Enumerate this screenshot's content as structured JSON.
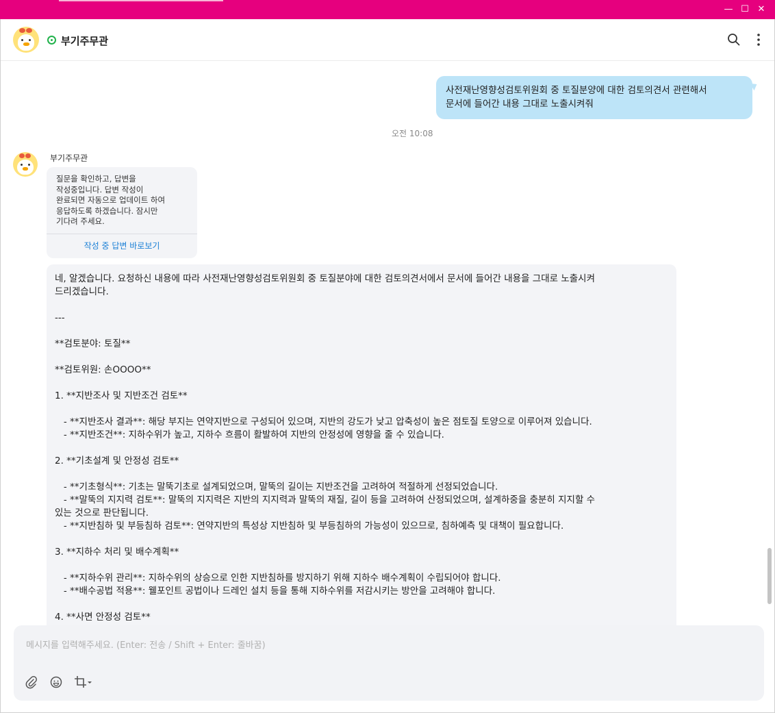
{
  "window": {
    "minimize": "—",
    "maximize": "☐",
    "close": "✕"
  },
  "header": {
    "name": "부기주무관"
  },
  "messages": {
    "user": {
      "text_line1": "사전재난영향성검토위원회 중 토질분양에 대한 검토의견서 관련해서",
      "text_line2": "문서에 들어간 내용 그대로 노출시켜줘",
      "time": "오전 10:08"
    },
    "bot_name": "부기주무관",
    "card": {
      "lines": [
        "질문을 확인하고, 답변을",
        "작성중입니다. 답변 작성이",
        "완료되면 자동으로 업데이트 하여",
        "응답하도록 하겠습니다. 잠시만",
        "기다려 주세요."
      ],
      "link": "작성 중 답변 바로보기"
    },
    "answer_lines": [
      "네, 알겠습니다. 요청하신 내용에 따라 사전재난영향성검토위원회 중 토질분야에 대한 검토의견서에서 문서에 들어간 내용을 그대로 노출시켜",
      "드리겠습니다.",
      "",
      "---",
      "",
      "**검토분야: 토질**",
      "",
      "**검토위원: 손OOOO**",
      "",
      "1. **지반조사 및 지반조건 검토**",
      "",
      "   - **지반조사 결과**: 해당 부지는 연약지반으로 구성되어 있으며, 지반의 강도가 낮고 압축성이 높은 점토질 토양으로 이루어져 있습니다.",
      "   - **지반조건**: 지하수위가 높고, 지하수 흐름이 활발하여 지반의 안정성에 영향을 줄 수 있습니다.",
      "",
      "2. **기초설계 및 안정성 검토**",
      "",
      "   - **기초형식**: 기초는 말뚝기초로 설계되었으며, 말뚝의 길이는 지반조건을 고려하여 적절하게 선정되었습니다.",
      "   - **말뚝의 지지력 검토**: 말뚝의 지지력은 지반의 지지력과 말뚝의 재질, 길이 등을 고려하여 산정되었으며, 설계하중을 충분히 지지할 수",
      "있는 것으로 판단됩니다.",
      "   - **지반침하 및 부등침하 검토**: 연약지반의 특성상 지반침하 및 부등침하의 가능성이 있으므로, 침하예측 및 대책이 필요합니다.",
      "",
      "3. **지하수 처리 및 배수계획**",
      "",
      "   - **지하수위 관리**: 지하수위의 상승으로 인한 지반침하를 방지하기 위해 지하수 배수계획이 수립되어야 합니다.",
      "   - **배수공법 적용**: 웰포인트 공법이나 드레인 설치 등을 통해 지하수위를 저감시키는 방안을 고려해야 합니다.",
      "",
      "4. **사면 안정성 검토**"
    ]
  },
  "input": {
    "placeholder": "메시지를 입력해주세요. (Enter: 전송 / Shift + Enter: 줄바꿈)",
    "value": ""
  },
  "drag_handle": "···",
  "icons": {
    "search": "search-icon",
    "more": "more-vertical-icon",
    "attach": "paperclip-icon",
    "emoji": "emoji-icon",
    "capture": "crop-icon",
    "scroll_down": "arrow-down-icon",
    "status": "online-status-icon"
  }
}
